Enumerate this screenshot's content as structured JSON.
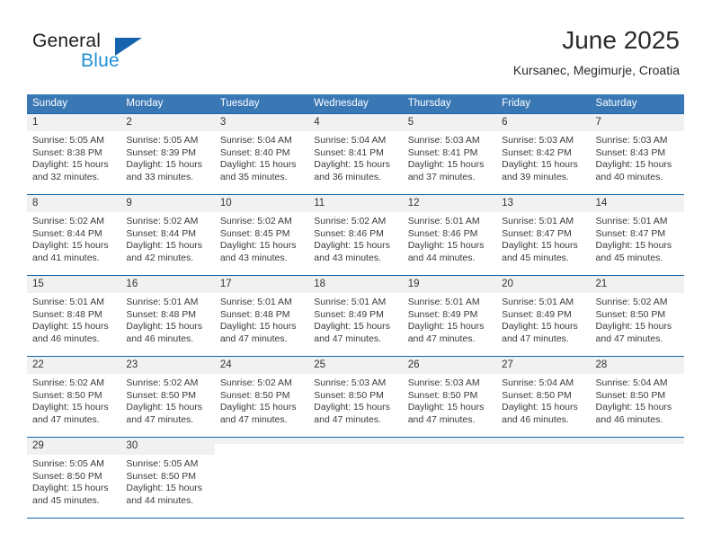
{
  "brand": {
    "line1": "General",
    "line2": "Blue",
    "logo_icon": "blue-triangle-icon",
    "accent_dark": "#1563ad",
    "accent_light": "#1e8fd5"
  },
  "header": {
    "title": "June 2025",
    "subtitle": "Kursanec, Megimurje, Croatia"
  },
  "theme": {
    "header_row_bg": "#3a78b5",
    "grid_line": "#1565a8",
    "daynum_bg": "#f1f1f1",
    "text": "#3a3a3a"
  },
  "calendar": {
    "weekday_headers": [
      "Sunday",
      "Monday",
      "Tuesday",
      "Wednesday",
      "Thursday",
      "Friday",
      "Saturday"
    ],
    "weeks": [
      [
        {
          "day": "1",
          "sunrise": "Sunrise: 5:05 AM",
          "sunset": "Sunset: 8:38 PM",
          "daylight1": "Daylight: 15 hours",
          "daylight2": "and 32 minutes."
        },
        {
          "day": "2",
          "sunrise": "Sunrise: 5:05 AM",
          "sunset": "Sunset: 8:39 PM",
          "daylight1": "Daylight: 15 hours",
          "daylight2": "and 33 minutes."
        },
        {
          "day": "3",
          "sunrise": "Sunrise: 5:04 AM",
          "sunset": "Sunset: 8:40 PM",
          "daylight1": "Daylight: 15 hours",
          "daylight2": "and 35 minutes."
        },
        {
          "day": "4",
          "sunrise": "Sunrise: 5:04 AM",
          "sunset": "Sunset: 8:41 PM",
          "daylight1": "Daylight: 15 hours",
          "daylight2": "and 36 minutes."
        },
        {
          "day": "5",
          "sunrise": "Sunrise: 5:03 AM",
          "sunset": "Sunset: 8:41 PM",
          "daylight1": "Daylight: 15 hours",
          "daylight2": "and 37 minutes."
        },
        {
          "day": "6",
          "sunrise": "Sunrise: 5:03 AM",
          "sunset": "Sunset: 8:42 PM",
          "daylight1": "Daylight: 15 hours",
          "daylight2": "and 39 minutes."
        },
        {
          "day": "7",
          "sunrise": "Sunrise: 5:03 AM",
          "sunset": "Sunset: 8:43 PM",
          "daylight1": "Daylight: 15 hours",
          "daylight2": "and 40 minutes."
        }
      ],
      [
        {
          "day": "8",
          "sunrise": "Sunrise: 5:02 AM",
          "sunset": "Sunset: 8:44 PM",
          "daylight1": "Daylight: 15 hours",
          "daylight2": "and 41 minutes."
        },
        {
          "day": "9",
          "sunrise": "Sunrise: 5:02 AM",
          "sunset": "Sunset: 8:44 PM",
          "daylight1": "Daylight: 15 hours",
          "daylight2": "and 42 minutes."
        },
        {
          "day": "10",
          "sunrise": "Sunrise: 5:02 AM",
          "sunset": "Sunset: 8:45 PM",
          "daylight1": "Daylight: 15 hours",
          "daylight2": "and 43 minutes."
        },
        {
          "day": "11",
          "sunrise": "Sunrise: 5:02 AM",
          "sunset": "Sunset: 8:46 PM",
          "daylight1": "Daylight: 15 hours",
          "daylight2": "and 43 minutes."
        },
        {
          "day": "12",
          "sunrise": "Sunrise: 5:01 AM",
          "sunset": "Sunset: 8:46 PM",
          "daylight1": "Daylight: 15 hours",
          "daylight2": "and 44 minutes."
        },
        {
          "day": "13",
          "sunrise": "Sunrise: 5:01 AM",
          "sunset": "Sunset: 8:47 PM",
          "daylight1": "Daylight: 15 hours",
          "daylight2": "and 45 minutes."
        },
        {
          "day": "14",
          "sunrise": "Sunrise: 5:01 AM",
          "sunset": "Sunset: 8:47 PM",
          "daylight1": "Daylight: 15 hours",
          "daylight2": "and 45 minutes."
        }
      ],
      [
        {
          "day": "15",
          "sunrise": "Sunrise: 5:01 AM",
          "sunset": "Sunset: 8:48 PM",
          "daylight1": "Daylight: 15 hours",
          "daylight2": "and 46 minutes."
        },
        {
          "day": "16",
          "sunrise": "Sunrise: 5:01 AM",
          "sunset": "Sunset: 8:48 PM",
          "daylight1": "Daylight: 15 hours",
          "daylight2": "and 46 minutes."
        },
        {
          "day": "17",
          "sunrise": "Sunrise: 5:01 AM",
          "sunset": "Sunset: 8:48 PM",
          "daylight1": "Daylight: 15 hours",
          "daylight2": "and 47 minutes."
        },
        {
          "day": "18",
          "sunrise": "Sunrise: 5:01 AM",
          "sunset": "Sunset: 8:49 PM",
          "daylight1": "Daylight: 15 hours",
          "daylight2": "and 47 minutes."
        },
        {
          "day": "19",
          "sunrise": "Sunrise: 5:01 AM",
          "sunset": "Sunset: 8:49 PM",
          "daylight1": "Daylight: 15 hours",
          "daylight2": "and 47 minutes."
        },
        {
          "day": "20",
          "sunrise": "Sunrise: 5:01 AM",
          "sunset": "Sunset: 8:49 PM",
          "daylight1": "Daylight: 15 hours",
          "daylight2": "and 47 minutes."
        },
        {
          "day": "21",
          "sunrise": "Sunrise: 5:02 AM",
          "sunset": "Sunset: 8:50 PM",
          "daylight1": "Daylight: 15 hours",
          "daylight2": "and 47 minutes."
        }
      ],
      [
        {
          "day": "22",
          "sunrise": "Sunrise: 5:02 AM",
          "sunset": "Sunset: 8:50 PM",
          "daylight1": "Daylight: 15 hours",
          "daylight2": "and 47 minutes."
        },
        {
          "day": "23",
          "sunrise": "Sunrise: 5:02 AM",
          "sunset": "Sunset: 8:50 PM",
          "daylight1": "Daylight: 15 hours",
          "daylight2": "and 47 minutes."
        },
        {
          "day": "24",
          "sunrise": "Sunrise: 5:02 AM",
          "sunset": "Sunset: 8:50 PM",
          "daylight1": "Daylight: 15 hours",
          "daylight2": "and 47 minutes."
        },
        {
          "day": "25",
          "sunrise": "Sunrise: 5:03 AM",
          "sunset": "Sunset: 8:50 PM",
          "daylight1": "Daylight: 15 hours",
          "daylight2": "and 47 minutes."
        },
        {
          "day": "26",
          "sunrise": "Sunrise: 5:03 AM",
          "sunset": "Sunset: 8:50 PM",
          "daylight1": "Daylight: 15 hours",
          "daylight2": "and 47 minutes."
        },
        {
          "day": "27",
          "sunrise": "Sunrise: 5:04 AM",
          "sunset": "Sunset: 8:50 PM",
          "daylight1": "Daylight: 15 hours",
          "daylight2": "and 46 minutes."
        },
        {
          "day": "28",
          "sunrise": "Sunrise: 5:04 AM",
          "sunset": "Sunset: 8:50 PM",
          "daylight1": "Daylight: 15 hours",
          "daylight2": "and 46 minutes."
        }
      ],
      [
        {
          "day": "29",
          "sunrise": "Sunrise: 5:05 AM",
          "sunset": "Sunset: 8:50 PM",
          "daylight1": "Daylight: 15 hours",
          "daylight2": "and 45 minutes."
        },
        {
          "day": "30",
          "sunrise": "Sunrise: 5:05 AM",
          "sunset": "Sunset: 8:50 PM",
          "daylight1": "Daylight: 15 hours",
          "daylight2": "and 44 minutes."
        },
        {
          "day": "",
          "sunrise": "",
          "sunset": "",
          "daylight1": "",
          "daylight2": "",
          "blank": true
        },
        {
          "day": "",
          "sunrise": "",
          "sunset": "",
          "daylight1": "",
          "daylight2": "",
          "blank": true
        },
        {
          "day": "",
          "sunrise": "",
          "sunset": "",
          "daylight1": "",
          "daylight2": "",
          "blank": true
        },
        {
          "day": "",
          "sunrise": "",
          "sunset": "",
          "daylight1": "",
          "daylight2": "",
          "blank": true
        },
        {
          "day": "",
          "sunrise": "",
          "sunset": "",
          "daylight1": "",
          "daylight2": "",
          "blank": true
        }
      ]
    ]
  }
}
